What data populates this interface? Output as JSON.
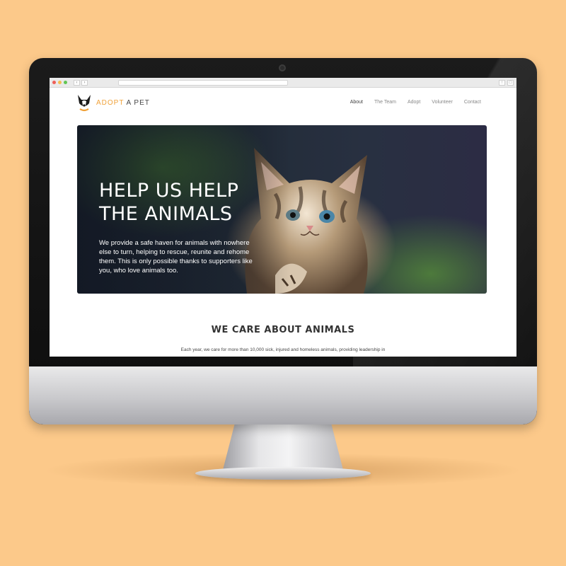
{
  "browser": {
    "traffic_lights": [
      "#ee5f58",
      "#f6be4f",
      "#62c654"
    ]
  },
  "site": {
    "logo": {
      "word1": "ADOPT",
      "word2": " A PET",
      "accent_color": "#f0a23a"
    },
    "nav": [
      "About",
      "The Team",
      "Adopt",
      "Volunteer",
      "Contact"
    ],
    "active_nav": "About"
  },
  "hero": {
    "title_line1": "HELP US HELP",
    "title_line2": "THE ANIMALS",
    "text": "We provide a safe haven for animals with nowhere else to turn, helping to rescue, reunite and rehome them. This is only possible thanks to supporters like you, who love animals too."
  },
  "section": {
    "title": "WE CARE ABOUT ANIMALS",
    "text": "Each year, we care for more than 10,000 sick, injured and homeless animals, providing leadership in"
  },
  "colors": {
    "background": "#fcc98a",
    "monitor_bezel": "#111111"
  }
}
